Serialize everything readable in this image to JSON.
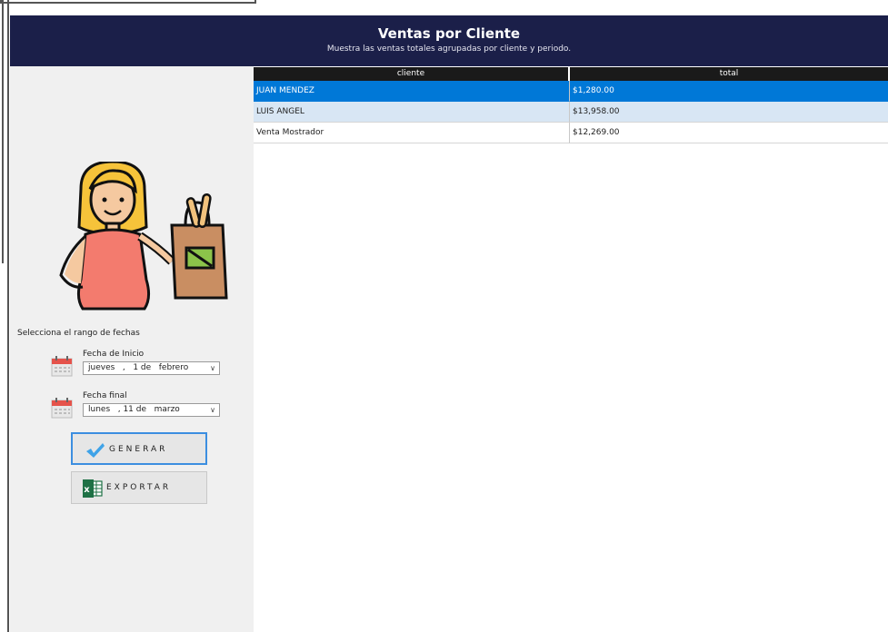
{
  "header": {
    "title": "Ventas por Cliente",
    "subtitle": "Muestra las ventas totales agrupadas por cliente y periodo."
  },
  "sidebar": {
    "range_label": "Selecciona el rango de fechas",
    "start": {
      "label": "Fecha de Inicio",
      "value": "jueves   ,   1 de   febrero"
    },
    "end": {
      "label": "Fecha final",
      "value": "lunes   , 11 de   marzo"
    },
    "generate_label": "GENERAR",
    "export_label": "EXPORTAR",
    "icons": {
      "illustration": "woman-shopping-bag-icon",
      "calendar": "calendar-icon",
      "generate": "checkmark-icon",
      "export": "excel-icon"
    }
  },
  "table": {
    "columns": [
      "cliente",
      "total"
    ],
    "rows": [
      {
        "cliente": "JUAN MENDEZ",
        "total": "$1,280.00",
        "state": "selected"
      },
      {
        "cliente": "LUIS ANGEL",
        "total": "$13,958.00",
        "state": "alt"
      },
      {
        "cliente": "Venta Mostrador",
        "total": "$12,269.00",
        "state": "normal"
      }
    ]
  },
  "colors": {
    "header_bg": "#1b1f49",
    "selected_row": "#0078d7",
    "alt_row": "#d8e6f4",
    "sidebar_bg": "#f0f0f0"
  }
}
